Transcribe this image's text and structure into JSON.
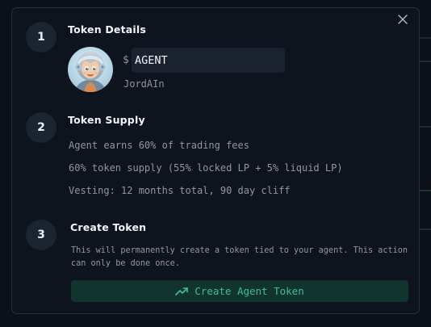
{
  "modal": {
    "close_icon": "close-icon"
  },
  "steps": [
    {
      "number": "1",
      "title": "Token Details",
      "token_symbol_prefix": "$",
      "token_symbol_value": "AGENT",
      "agent_name": "JordAIn",
      "avatar_icon": "agent-avatar-icon"
    },
    {
      "number": "2",
      "title": "Token Supply",
      "lines": [
        "Agent earns 60% of trading fees",
        "60% token supply (55% locked LP + 5% liquid LP)",
        "Vesting: 12 months total, 90 day cliff"
      ]
    },
    {
      "number": "3",
      "title": "Create Token",
      "description": "This will permanently create a token tied to your agent. This action can only be done once.",
      "button_label": "Create Agent Token",
      "button_icon": "trending-up-icon"
    }
  ],
  "colors": {
    "accent": "#3fbf95",
    "button_bg": "#12342e",
    "modal_bg": "#0e141d",
    "step_circle": "#1b2430"
  }
}
